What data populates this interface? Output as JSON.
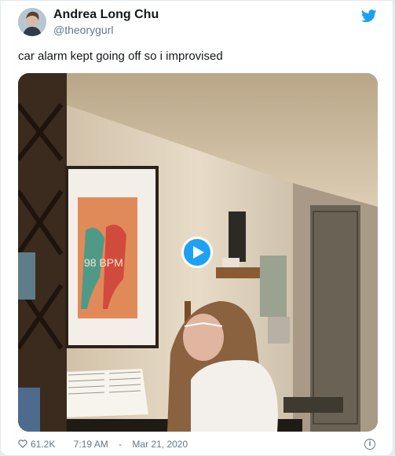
{
  "tweet": {
    "author_name": "Andrea Long Chu",
    "author_handle": "@theorygurl",
    "text": "car alarm kept going off so i improvised",
    "poster_text": "98 BPM",
    "likes": "61.2K",
    "time": "7:19 AM",
    "date": "Mar 21, 2020"
  },
  "colors": {
    "brand": "#1da1f2",
    "name": "#14171a",
    "secondary": "#657786"
  },
  "icons": {
    "logo": "twitter-bird-icon",
    "play": "play-icon",
    "like": "heart-icon",
    "info": "info-icon"
  }
}
